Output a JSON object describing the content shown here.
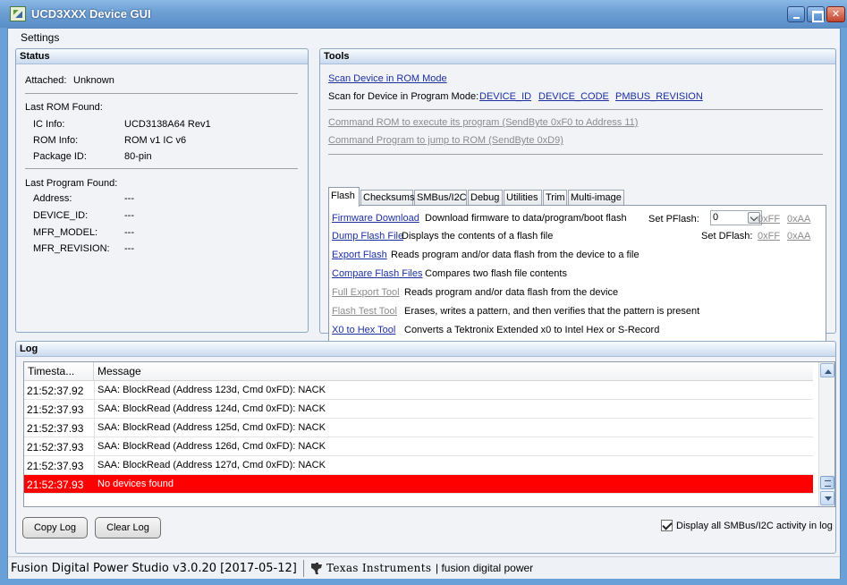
{
  "window": {
    "title": "UCD3XXX Device GUI"
  },
  "menu": {
    "settings": "Settings"
  },
  "status": {
    "title": "Status",
    "attached_label": "Attached:",
    "attached_value": "Unknown",
    "last_rom_title": "Last ROM Found:",
    "rom_rows": [
      {
        "label": "IC Info:",
        "value": "UCD3138A64 Rev1"
      },
      {
        "label": "ROM Info:",
        "value": "ROM v1 IC v6"
      },
      {
        "label": "Package ID:",
        "value": "80-pin"
      }
    ],
    "last_program_title": "Last Program Found:",
    "program_rows": [
      {
        "label": "Address:",
        "value": "---"
      },
      {
        "label": "DEVICE_ID:",
        "value": "---"
      },
      {
        "label": "MFR_MODEL:",
        "value": "---"
      },
      {
        "label": "MFR_REVISION:",
        "value": "---"
      }
    ]
  },
  "tools": {
    "title": "Tools",
    "scan_rom": "Scan Device in ROM Mode",
    "scan_program_label": "Scan for Device in Program Mode:",
    "scan_links": [
      "DEVICE_ID",
      "DEVICE_CODE",
      "PMBUS_REVISION"
    ],
    "cmd_rom": "Command ROM to execute its program (SendByte 0xF0 to Address 11)",
    "cmd_program": "Command Program to jump to ROM (SendByte 0xD9)",
    "tabs": [
      "Flash",
      "Checksums",
      "SMBus/I2C",
      "Debug",
      "Utilities",
      "Trim",
      "Multi-image"
    ],
    "flash_rows": [
      {
        "link": "Firmware Download",
        "desc": "Download firmware to data/program/boot flash",
        "enabled": true
      },
      {
        "link": "Dump Flash File",
        "desc": "Displays the contents of a flash file",
        "enabled": true
      },
      {
        "link": "Export Flash",
        "desc": "Reads program and/or data flash from the device to a file",
        "enabled": true
      },
      {
        "link": "Compare Flash Files",
        "desc": "Compares two flash file contents",
        "enabled": true
      },
      {
        "link": "Full Export Tool",
        "desc": "Reads program and/or data flash from the device",
        "enabled": false
      },
      {
        "link": "Flash Test Tool",
        "desc": "Erases, writes a pattern, and then verifies that the pattern is present",
        "enabled": false
      },
      {
        "link": "X0 to Hex Tool",
        "desc": "Converts a Tektronix Extended x0 to Intel Hex or S-Record",
        "enabled": true
      }
    ],
    "set_pflash_label": "Set PFlash:",
    "pflash_value": "0",
    "set_dflash_label": "Set DFlash:",
    "hex_ff": "0xFF",
    "hex_aa": "0xAA"
  },
  "log": {
    "title": "Log",
    "columns": [
      "Timesta...",
      "Message"
    ],
    "rows": [
      {
        "time": "21:52:37.92",
        "msg": "SAA: BlockRead (Address 123d, Cmd 0xFD): NACK"
      },
      {
        "time": "21:52:37.93",
        "msg": "SAA: BlockRead (Address 124d, Cmd 0xFD): NACK"
      },
      {
        "time": "21:52:37.93",
        "msg": "SAA: BlockRead (Address 125d, Cmd 0xFD): NACK"
      },
      {
        "time": "21:52:37.93",
        "msg": "SAA: BlockRead (Address 126d, Cmd 0xFD): NACK"
      },
      {
        "time": "21:52:37.93",
        "msg": "SAA: BlockRead (Address 127d, Cmd 0xFD): NACK"
      },
      {
        "time": "21:52:37.93",
        "msg": "No devices found",
        "error": true
      }
    ],
    "copy_button": "Copy Log",
    "clear_button": "Clear Log",
    "display_all_label": "Display all SMBus/I2C activity in log",
    "display_all_checked": true,
    "error_color": "#ff0000"
  },
  "statusbar": {
    "app_version": "Fusion Digital Power Studio v3.0.20 [2017-05-12]",
    "brand": "Texas Instruments",
    "tagline": "| fusion digital power"
  }
}
